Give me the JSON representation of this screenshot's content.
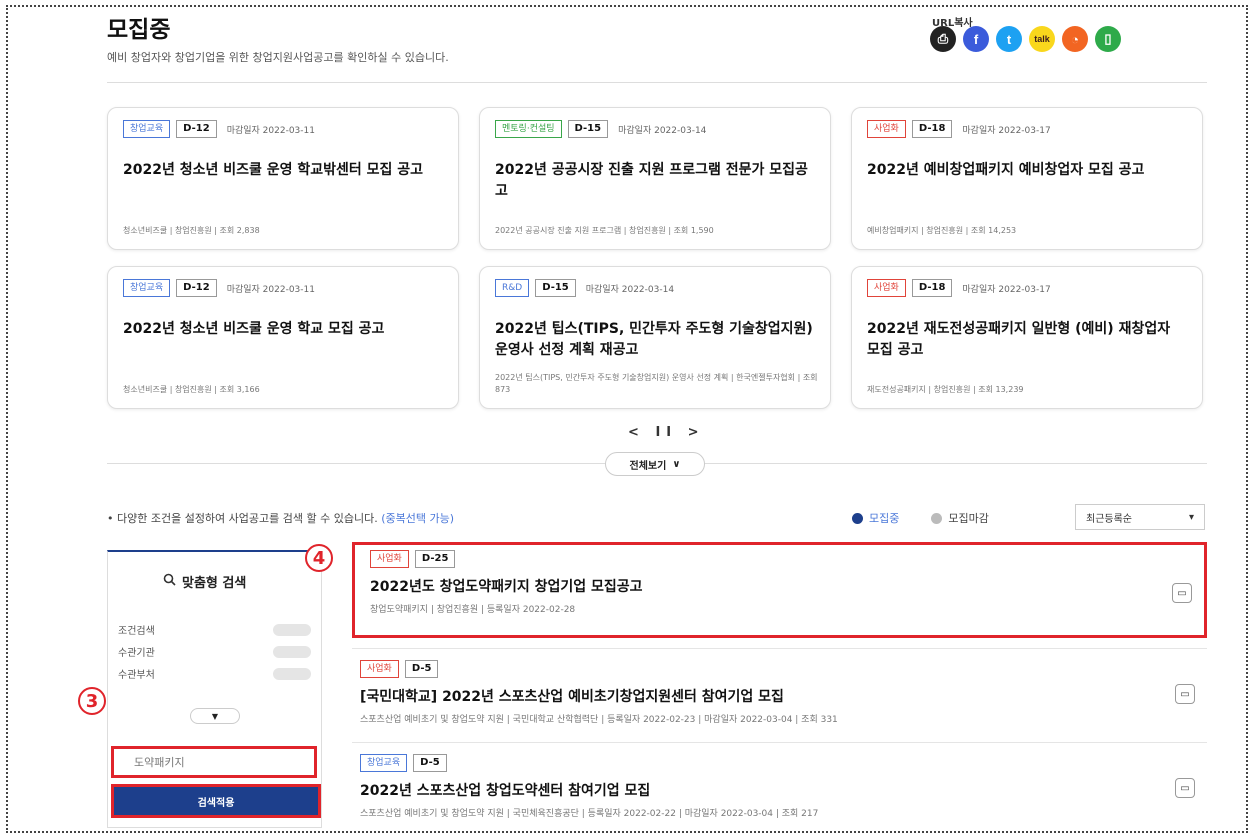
{
  "header": {
    "title": "모집중",
    "subtitle": "예비 창업자와 창업기업을 위한 창업지원사업공고를 확인하실 수 있습니다.",
    "url_copy_label": "URL복사",
    "share_icons": [
      "print-icon",
      "facebook-icon",
      "twitter-icon",
      "kakaotalk-icon",
      "rss-icon",
      "bookmark-icon"
    ]
  },
  "cards": [
    {
      "category": "창업교육",
      "dday": "D-12",
      "deadline": "마감일자 2022-03-11",
      "title": "2022년 청소년 비즈쿨 운영 학교밖센터 모집 공고",
      "meta": "청소년비즈쿨 | 창업진흥원 | 조회 2,838"
    },
    {
      "category": "멘토링·컨설팅",
      "dday": "D-15",
      "deadline": "마감일자 2022-03-14",
      "title": "2022년 공공시장 진출 지원 프로그램 전문가 모집공고",
      "meta": "2022년 공공시장 진출 지원 프로그램 | 창업진흥원 | 조회 1,590"
    },
    {
      "category": "사업화",
      "dday": "D-18",
      "deadline": "마감일자 2022-03-17",
      "title": "2022년 예비창업패키지 예비창업자 모집 공고",
      "meta": "예비창업패키지 | 창업진흥원 | 조회 14,253"
    },
    {
      "category": "창업교육",
      "dday": "D-12",
      "deadline": "마감일자 2022-03-11",
      "title": "2022년 청소년 비즈쿨 운영 학교 모집 공고",
      "meta": "청소년비즈쿨 | 창업진흥원 | 조회 3,166"
    },
    {
      "category": "R&D",
      "dday": "D-15",
      "deadline": "마감일자 2022-03-14",
      "title": "2022년 팁스(TIPS, 민간투자 주도형 기술창업지원) 운영사 선정 계획 재공고",
      "meta": "2022년 팁스(TIPS, 민간투자 주도형 기술창업지원) 운영사 선정 계획 | 한국엔젤투자협회 | 조회 873"
    },
    {
      "category": "사업화",
      "dday": "D-18",
      "deadline": "마감일자 2022-03-17",
      "title": "2022년 재도전성공패키지 일반형 (예비) 재창업자 모집 공고",
      "meta": "재도전성공패키지 | 창업진흥원 | 조회 13,239"
    }
  ],
  "pager": {
    "prev": "<",
    "pause": "II",
    "next": ">"
  },
  "view_all": {
    "label": "전체보기",
    "chevron": "∨"
  },
  "filter": {
    "guide": "• 다양한 조건을 설정하여 사업공고를 검색 할 수 있습니다.",
    "guide_highlight": "(중복선택 가능)",
    "status_open": "모집중",
    "status_closed": "모집마감",
    "sort": "최근등록순",
    "sort_arrow": "▾"
  },
  "side": {
    "title": "맞춤형 검색",
    "rows": [
      "조건검색",
      "수관기관",
      "수관부처"
    ],
    "expand": "▼",
    "search_value": "도약패키지",
    "apply": "검색적용"
  },
  "markers": {
    "m3": "3",
    "m4": "4"
  },
  "results": [
    {
      "category": "사업화",
      "dday": "D-25",
      "title": "2022년도 창업도약패키지 창업기업 모집공고",
      "meta": "창업도약패키지 | 창업진흥원 | 등록일자 2022-02-28"
    },
    {
      "category": "사업화",
      "dday": "D-5",
      "title": "[국민대학교] 2022년 스포츠산업 예비초기창업지원센터 참여기업 모집",
      "meta": "스포츠산업 예비초기 및 창업도약 지원 | 국민대학교 산학협력단 | 등록일자 2022-02-23 | 마감일자 2022-03-04 | 조회 331"
    },
    {
      "category": "창업교육",
      "dday": "D-5",
      "title": "2022년 스포츠산업 창업도약센터 참여기업 모집",
      "meta": "스포츠산업 예비초기 및 창업도약 지원 | 국민체육진흥공단 | 등록일자 2022-02-22 | 마감일자 2022-03-04 | 조회 217"
    }
  ],
  "colors": {
    "accent_blue": "#1d3f8c",
    "highlight_red": "#e0242b",
    "open_dot": "#1d3f8c",
    "closed_dot": "#bbbbbb"
  }
}
